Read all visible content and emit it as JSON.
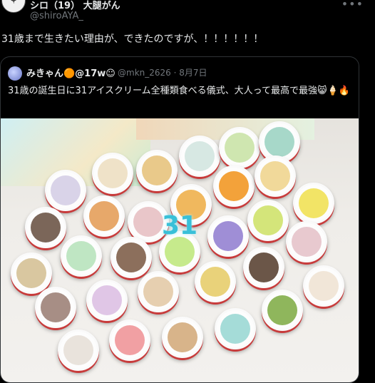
{
  "tweet": {
    "display_name": "シロ（19） 大腿がん",
    "handle": "@shiroAYA_",
    "text": "31歳まで生きたい理由が、できたのですが、！！！！！！"
  },
  "quoted": {
    "display_name": "みきゃん🟠@17w☺",
    "handle_date": "@mkn_2626 · 8月7日",
    "text": "31歳の誕生日に31アイスクリーム全種類食べる儀式、大人って最高で最強😸🍦🔥",
    "image_caption_number": "31"
  },
  "icons": {
    "more": "more-dots-icon",
    "avatar": "user-avatar-icon"
  },
  "colors": {
    "background": "#000000",
    "text": "#e7e9ea",
    "muted": "#71767b",
    "border": "#2f3336"
  }
}
